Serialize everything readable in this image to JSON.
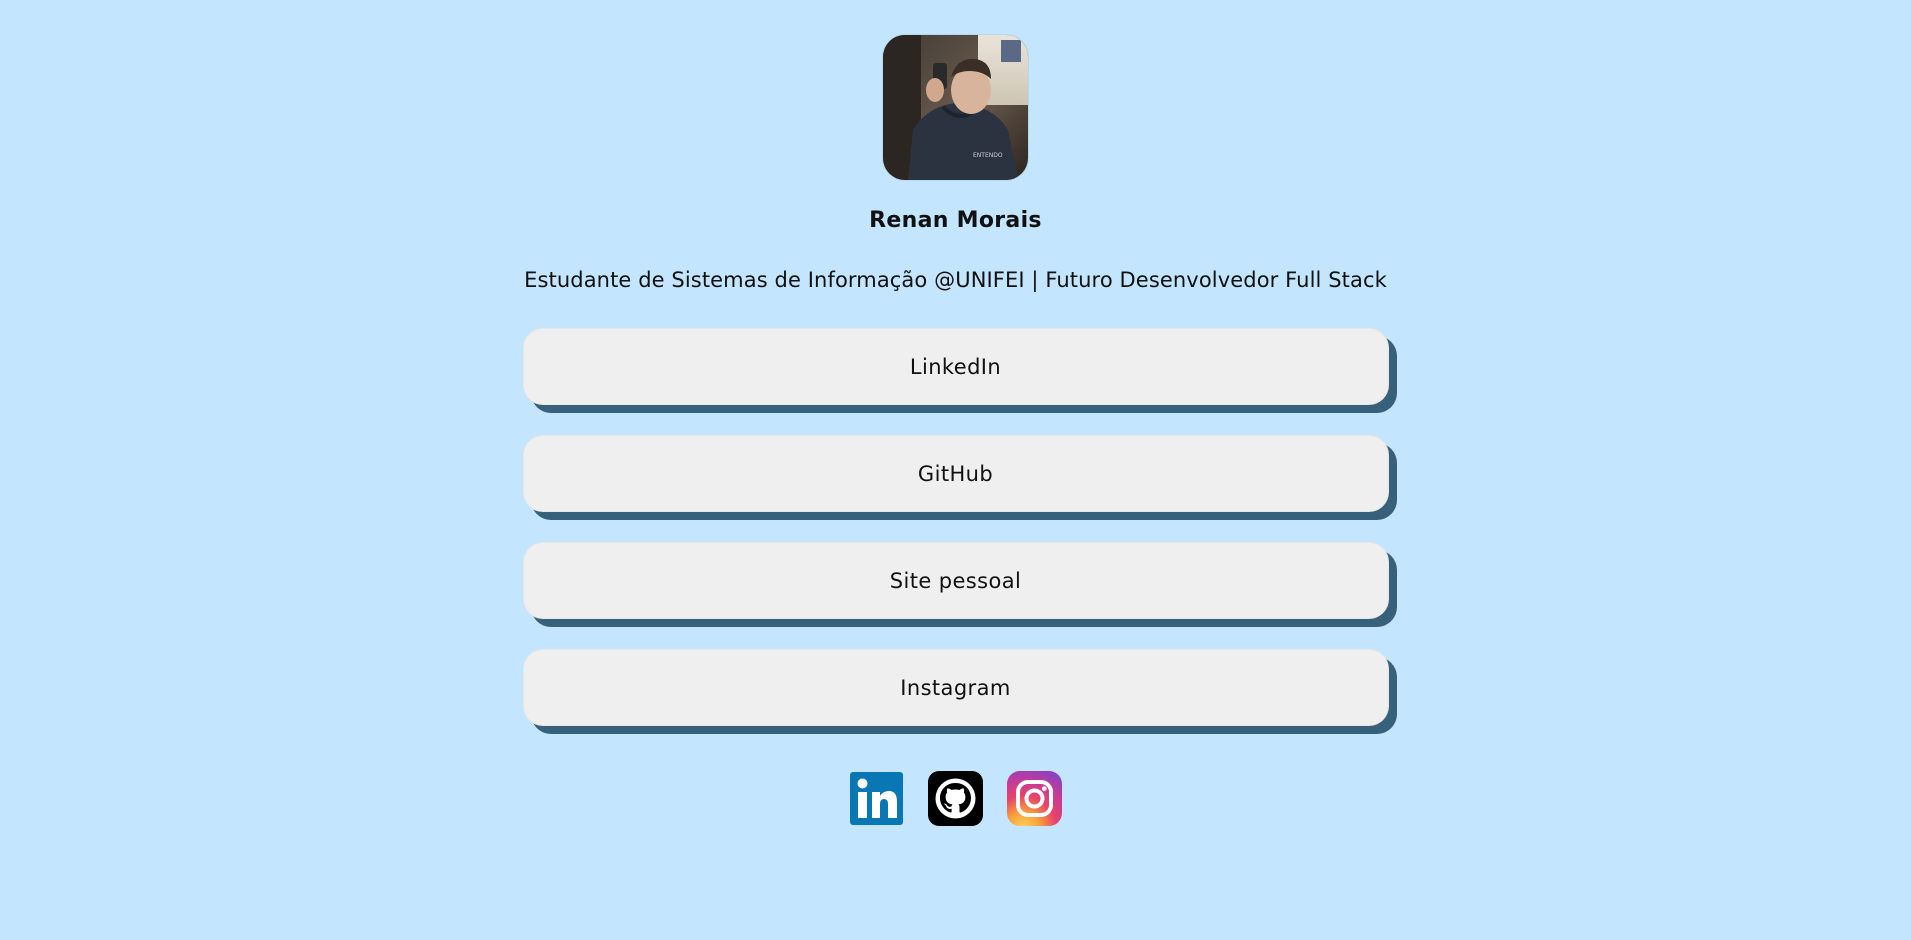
{
  "profile": {
    "name": "Renan Morais",
    "bio": "Estudante de Sistemas de Informação @UNIFEI | Futuro Desenvolvedor Full Stack"
  },
  "links": [
    {
      "label": "LinkedIn"
    },
    {
      "label": "GitHub"
    },
    {
      "label": "Site pessoal"
    },
    {
      "label": "Instagram"
    }
  ],
  "socials": [
    {
      "icon": "linkedin-icon"
    },
    {
      "icon": "github-icon"
    },
    {
      "icon": "instagram-icon"
    }
  ],
  "colors": {
    "background": "#c3e5fe",
    "button": "#efefef",
    "button_shadow": "#37607a",
    "linkedin": "#0a77b5",
    "github": "#000000"
  }
}
